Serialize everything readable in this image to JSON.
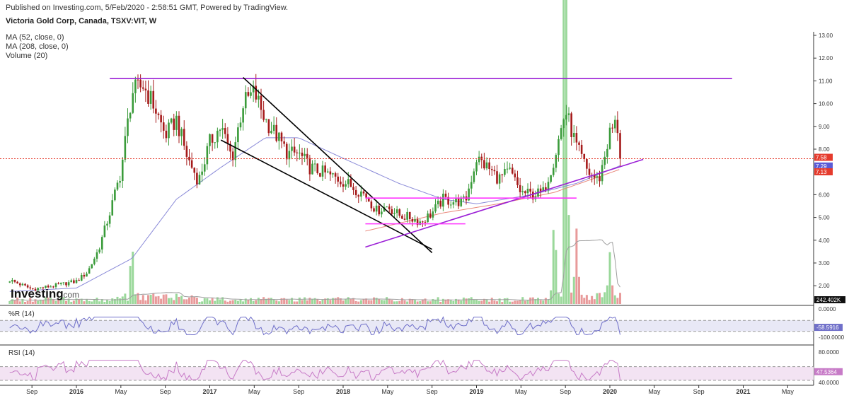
{
  "header": {
    "publish_line": "Published on Investing.com, 5/Feb/2020 - 2:58:51 GMT, Powered by TradingView.",
    "title": "Victoria Gold Corp, Canada, TSXV:VIT, W"
  },
  "legend": [
    "MA (52, close, 0)",
    "MA (208, close, 0)",
    "Volume (20)"
  ],
  "logo": {
    "main": "Investing",
    "sub": ".com"
  },
  "colors": {
    "up": "#3a9b3a",
    "down": "#a51a1a",
    "ma52": "#8a8ad8",
    "ma208": "#e9877a",
    "trendline": "#9b1fd6",
    "wedge": "#000000",
    "price_line": "#e53b2d",
    "wpr": "#6f6fc9",
    "wpr_fill": "#e8e8f6",
    "rsi": "#c77bc7",
    "rsi_fill": "#f3e3f3",
    "volume_up": "#9ad89a",
    "volume_down": "#e89a9a",
    "volume_ma": "#9e9e9e"
  },
  "chart_data": [
    {
      "type": "candlestick",
      "name": "Victoria Gold Corp, Canada, TSXV:VIT, W",
      "x_range": [
        "2015-07",
        "2021-07"
      ],
      "ylim": [
        1.4,
        13.2
      ],
      "y_ticks": [
        "13.00",
        "12.00",
        "11.00",
        "10.00",
        "9.00",
        "8.00",
        "6.00",
        "5.00",
        "4.00",
        "3.00",
        "2.00"
      ],
      "x_ticks": [
        {
          "label": "Sep",
          "date": "2015-09",
          "bold": false
        },
        {
          "label": "2016",
          "date": "2016-01",
          "bold": true
        },
        {
          "label": "May",
          "date": "2016-05",
          "bold": false
        },
        {
          "label": "Sep",
          "date": "2016-09",
          "bold": false
        },
        {
          "label": "2017",
          "date": "2017-01",
          "bold": true
        },
        {
          "label": "May",
          "date": "2017-05",
          "bold": false
        },
        {
          "label": "Sep",
          "date": "2017-09",
          "bold": false
        },
        {
          "label": "2018",
          "date": "2018-01",
          "bold": true
        },
        {
          "label": "May",
          "date": "2018-05",
          "bold": false
        },
        {
          "label": "Sep",
          "date": "2018-09",
          "bold": false
        },
        {
          "label": "2019",
          "date": "2019-01",
          "bold": true
        },
        {
          "label": "May",
          "date": "2019-05",
          "bold": false
        },
        {
          "label": "Sep",
          "date": "2019-09",
          "bold": false
        },
        {
          "label": "2020",
          "date": "2020-01",
          "bold": true
        },
        {
          "label": "May",
          "date": "2020-05",
          "bold": false
        },
        {
          "label": "Sep",
          "date": "2020-09",
          "bold": false
        },
        {
          "label": "2021",
          "date": "2021-01",
          "bold": true
        },
        {
          "label": "May",
          "date": "2021-05",
          "bold": false
        }
      ],
      "close_keyframes": [
        [
          "2015-07",
          2.25
        ],
        [
          "2015-09",
          1.85
        ],
        [
          "2015-11",
          2.0
        ],
        [
          "2016-01",
          2.2
        ],
        [
          "2016-02",
          2.6
        ],
        [
          "2016-03",
          3.6
        ],
        [
          "2016-04",
          5.2
        ],
        [
          "2016-05",
          7.0
        ],
        [
          "2016-06",
          10.5
        ],
        [
          "2016-07",
          10.8
        ],
        [
          "2016-08",
          9.9
        ],
        [
          "2016-09",
          8.6
        ],
        [
          "2016-10",
          9.3
        ],
        [
          "2016-11",
          7.6
        ],
        [
          "2016-12",
          6.6
        ],
        [
          "2017-01",
          8.3
        ],
        [
          "2017-02",
          9.0
        ],
        [
          "2017-03",
          7.6
        ],
        [
          "2017-04",
          10.0
        ],
        [
          "2017-05",
          10.5
        ],
        [
          "2017-06",
          9.3
        ],
        [
          "2017-07",
          8.6
        ],
        [
          "2017-08",
          7.8
        ],
        [
          "2017-09",
          7.8
        ],
        [
          "2017-10",
          7.2
        ],
        [
          "2017-11",
          7.0
        ],
        [
          "2017-12",
          6.8
        ],
        [
          "2018-01",
          6.6
        ],
        [
          "2018-02",
          6.3
        ],
        [
          "2018-03",
          6.0
        ],
        [
          "2018-04",
          5.3
        ],
        [
          "2018-05",
          5.5
        ],
        [
          "2018-06",
          5.1
        ],
        [
          "2018-07",
          5.0
        ],
        [
          "2018-08",
          4.8
        ],
        [
          "2018-09",
          5.2
        ],
        [
          "2018-10",
          5.8
        ],
        [
          "2018-11",
          5.7
        ],
        [
          "2018-12",
          5.7
        ],
        [
          "2019-01",
          7.6
        ],
        [
          "2019-02",
          7.2
        ],
        [
          "2019-03",
          6.7
        ],
        [
          "2019-04",
          7.0
        ],
        [
          "2019-05",
          6.1
        ],
        [
          "2019-06",
          6.0
        ],
        [
          "2019-07",
          6.1
        ],
        [
          "2019-08",
          7.6
        ],
        [
          "2019-09",
          9.7
        ],
        [
          "2019-10",
          8.1
        ],
        [
          "2019-11",
          7.0
        ],
        [
          "2019-12",
          6.6
        ],
        [
          "2020-01",
          8.7
        ],
        [
          "2020-01-20",
          9.2
        ],
        [
          "2020-02",
          7.58
        ]
      ],
      "last_price": "7.58",
      "price_tags": [
        {
          "label": "7.58",
          "value": 7.58,
          "color": "#e53b2d"
        },
        {
          "label": "7.29",
          "value": 7.29,
          "color": "#5b5bd6"
        },
        {
          "label": "7.13",
          "value": 7.13,
          "color": "#e53b2d"
        }
      ],
      "ma52_keyframes": [
        [
          "2015-07",
          1.75
        ],
        [
          "2016-01",
          1.9
        ],
        [
          "2016-06",
          3.2
        ],
        [
          "2016-10",
          5.8
        ],
        [
          "2017-02",
          7.2
        ],
        [
          "2017-06",
          8.5
        ],
        [
          "2017-09",
          8.5
        ],
        [
          "2018-01",
          7.6
        ],
        [
          "2018-06",
          6.5
        ],
        [
          "2018-10",
          5.8
        ],
        [
          "2019-01",
          5.6
        ],
        [
          "2019-06",
          6.0
        ],
        [
          "2019-10",
          6.5
        ],
        [
          "2020-02",
          7.29
        ]
      ],
      "ma208_keyframes": [
        [
          "2018-03",
          4.4
        ],
        [
          "2018-10",
          5.2
        ],
        [
          "2019-03",
          5.6
        ],
        [
          "2019-08",
          6.1
        ],
        [
          "2020-02",
          7.13
        ]
      ],
      "annotations": [
        {
          "kind": "trendline",
          "color": "#9b1fd6",
          "from": [
            "2016-04",
            11.1
          ],
          "to": [
            "2020-12",
            11.1
          ]
        },
        {
          "kind": "trendline",
          "color": "#000000",
          "from": [
            "2017-04",
            11.15
          ],
          "to": [
            "2018-09",
            3.45
          ]
        },
        {
          "kind": "trendline",
          "color": "#000000",
          "from": [
            "2017-02",
            8.4
          ],
          "to": [
            "2018-09",
            3.6
          ]
        },
        {
          "kind": "trendline",
          "color": "#9b1fd6",
          "from": [
            "2018-03",
            3.7
          ],
          "to": [
            "2020-04",
            7.55
          ]
        },
        {
          "kind": "trendline",
          "color": "#ff33ff",
          "from": [
            "2018-03",
            5.85
          ],
          "to": [
            "2019-10",
            5.85
          ]
        },
        {
          "kind": "trendline",
          "color": "#ff33ff",
          "from": [
            "2018-03",
            4.72
          ],
          "to": [
            "2018-12",
            4.72
          ]
        }
      ]
    },
    {
      "type": "bar",
      "name": "Volume (20)",
      "last_value": "242.402K",
      "spikes": [
        [
          "2016-06",
          3.0
        ],
        [
          "2019-08",
          4.0
        ],
        [
          "2019-09",
          26.0
        ],
        [
          "2019-10",
          3.2
        ],
        [
          "2020-01",
          2.2
        ]
      ]
    },
    {
      "type": "line",
      "name": "%R (14)",
      "ylim": [
        -100,
        0
      ],
      "y_ticks": [
        "0.0000",
        "-100.0000"
      ],
      "levels": [
        -20,
        -80
      ],
      "last_value": "-58.5916"
    },
    {
      "type": "line",
      "name": "RSI (14)",
      "ylim": [
        30,
        90
      ],
      "y_ticks": [
        "80.0000",
        "40.0000"
      ],
      "levels": [
        70,
        30
      ],
      "last_value": "47.5364"
    }
  ]
}
